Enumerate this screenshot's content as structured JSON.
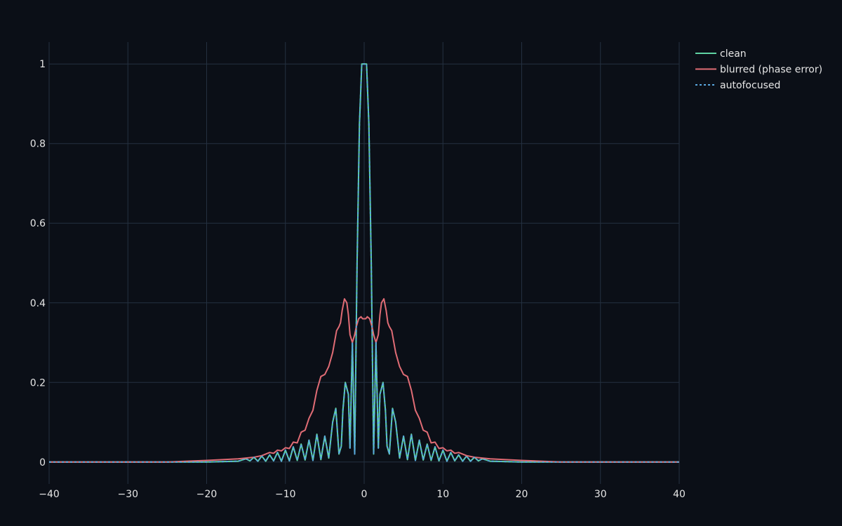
{
  "chart_data": {
    "type": "line",
    "title": "",
    "xlabel": "",
    "ylabel": "",
    "xlim": [
      -40,
      40
    ],
    "ylim": [
      -0.055,
      1.055
    ],
    "grid": true,
    "legend_position": "top-right",
    "x_ticks": [
      -40,
      -30,
      -20,
      -10,
      0,
      10,
      20,
      30,
      40
    ],
    "x_tick_labels": [
      "−40",
      "−30",
      "−20",
      "−10",
      "0",
      "10",
      "20",
      "30",
      "40"
    ],
    "y_ticks": [
      0,
      0.2,
      0.4,
      0.6,
      0.8,
      1
    ],
    "y_tick_labels": [
      "0",
      "0.2",
      "0.4",
      "0.6",
      "0.8",
      "1"
    ],
    "series": [
      {
        "name": "clean",
        "color": "#5fd3a3",
        "dash": "solid",
        "x": [
          -40,
          -30,
          -20,
          -16,
          -15,
          -14.5,
          -14,
          -13.5,
          -13,
          -12.5,
          -12,
          -11.5,
          -11,
          -10.5,
          -10,
          -9.5,
          -9,
          -8.5,
          -8,
          -7.5,
          -7,
          -6.5,
          -6,
          -5.5,
          -5,
          -4.5,
          -4,
          -3.6,
          -3.2,
          -2.9,
          -2.7,
          -2.4,
          -2.0,
          -1.8,
          -1.5,
          -1.2,
          -0.9,
          -0.6,
          -0.3,
          -0.15,
          0,
          0.15,
          0.3,
          0.6,
          0.9,
          1.2,
          1.5,
          1.8,
          2.0,
          2.4,
          2.7,
          2.9,
          3.2,
          3.6,
          4,
          4.5,
          5,
          5.5,
          6,
          6.5,
          7,
          7.5,
          8,
          8.5,
          9,
          9.5,
          10,
          10.5,
          11,
          11.5,
          12,
          12.5,
          13,
          13.5,
          14,
          14.5,
          15,
          16,
          20,
          30,
          40
        ],
        "y": [
          0,
          0,
          0,
          0.002,
          0.008,
          0.003,
          0.012,
          0.002,
          0.015,
          0.002,
          0.018,
          0.003,
          0.024,
          0.002,
          0.03,
          0.003,
          0.038,
          0.004,
          0.045,
          0.005,
          0.055,
          0.004,
          0.07,
          0.006,
          0.065,
          0.01,
          0.1,
          0.135,
          0.02,
          0.04,
          0.13,
          0.2,
          0.17,
          0.035,
          0.3,
          0.02,
          0.5,
          0.85,
          1.0,
          1.0,
          1.0,
          1.0,
          1.0,
          0.85,
          0.5,
          0.02,
          0.3,
          0.035,
          0.17,
          0.2,
          0.13,
          0.04,
          0.02,
          0.135,
          0.1,
          0.01,
          0.065,
          0.006,
          0.07,
          0.004,
          0.055,
          0.005,
          0.045,
          0.004,
          0.038,
          0.003,
          0.03,
          0.002,
          0.024,
          0.003,
          0.018,
          0.002,
          0.015,
          0.002,
          0.012,
          0.003,
          0.008,
          0.002,
          0,
          0,
          0
        ]
      },
      {
        "name": "blurred (phase error)",
        "color": "#e06c75",
        "dash": "solid",
        "x": [
          -40,
          -30,
          -25,
          -20,
          -18,
          -16,
          -14,
          -13,
          -12.5,
          -12,
          -11.5,
          -11,
          -10.5,
          -10,
          -9.5,
          -9,
          -8.5,
          -8,
          -7.5,
          -7,
          -6.5,
          -6,
          -5.5,
          -5,
          -4.5,
          -4,
          -3.5,
          -3.2,
          -3,
          -2.8,
          -2.5,
          -2.2,
          -2,
          -1.8,
          -1.5,
          -1.2,
          -1,
          -0.7,
          -0.4,
          -0.2,
          0,
          0.2,
          0.4,
          0.7,
          1,
          1.2,
          1.5,
          1.8,
          2,
          2.2,
          2.5,
          2.8,
          3,
          3.2,
          3.5,
          4,
          4.5,
          5,
          5.5,
          6,
          6.5,
          7,
          7.5,
          8,
          8.5,
          9,
          9.5,
          10,
          10.5,
          11,
          11.5,
          12,
          12.5,
          13,
          14,
          16,
          18,
          20,
          25,
          30,
          40
        ],
        "y": [
          0,
          0,
          0,
          0.004,
          0.006,
          0.008,
          0.012,
          0.016,
          0.02,
          0.024,
          0.022,
          0.03,
          0.028,
          0.036,
          0.034,
          0.05,
          0.048,
          0.075,
          0.08,
          0.11,
          0.13,
          0.18,
          0.215,
          0.22,
          0.24,
          0.275,
          0.33,
          0.34,
          0.35,
          0.38,
          0.41,
          0.4,
          0.37,
          0.32,
          0.3,
          0.32,
          0.34,
          0.36,
          0.365,
          0.36,
          0.36,
          0.36,
          0.365,
          0.36,
          0.34,
          0.32,
          0.3,
          0.32,
          0.37,
          0.4,
          0.41,
          0.38,
          0.35,
          0.34,
          0.33,
          0.275,
          0.24,
          0.22,
          0.215,
          0.18,
          0.13,
          0.11,
          0.08,
          0.075,
          0.048,
          0.05,
          0.034,
          0.036,
          0.028,
          0.03,
          0.022,
          0.024,
          0.02,
          0.016,
          0.012,
          0.008,
          0.006,
          0.004,
          0,
          0,
          0
        ]
      },
      {
        "name": "autofocused",
        "color": "#5aa8e0",
        "dash": "dotted",
        "x": [
          -40,
          -30,
          -20,
          -16,
          -15,
          -14.5,
          -14,
          -13.5,
          -13,
          -12.5,
          -12,
          -11.5,
          -11,
          -10.5,
          -10,
          -9.5,
          -9,
          -8.5,
          -8,
          -7.5,
          -7,
          -6.5,
          -6,
          -5.5,
          -5,
          -4.5,
          -4,
          -3.6,
          -3.2,
          -2.9,
          -2.7,
          -2.4,
          -2.0,
          -1.8,
          -1.5,
          -1.2,
          -0.9,
          -0.6,
          -0.3,
          -0.15,
          0,
          0.15,
          0.3,
          0.6,
          0.9,
          1.2,
          1.5,
          1.8,
          2.0,
          2.4,
          2.7,
          2.9,
          3.2,
          3.6,
          4,
          4.5,
          5,
          5.5,
          6,
          6.5,
          7,
          7.5,
          8,
          8.5,
          9,
          9.5,
          10,
          10.5,
          11,
          11.5,
          12,
          12.5,
          13,
          13.5,
          14,
          14.5,
          15,
          16,
          20,
          30,
          40
        ],
        "y": [
          0,
          0,
          0,
          0.002,
          0.008,
          0.003,
          0.012,
          0.002,
          0.015,
          0.002,
          0.018,
          0.003,
          0.024,
          0.002,
          0.03,
          0.003,
          0.038,
          0.004,
          0.045,
          0.005,
          0.055,
          0.004,
          0.07,
          0.006,
          0.065,
          0.01,
          0.1,
          0.135,
          0.02,
          0.04,
          0.13,
          0.2,
          0.17,
          0.035,
          0.3,
          0.02,
          0.5,
          0.85,
          1.0,
          1.0,
          1.0,
          1.0,
          1.0,
          0.85,
          0.5,
          0.02,
          0.3,
          0.035,
          0.17,
          0.2,
          0.13,
          0.04,
          0.02,
          0.135,
          0.1,
          0.01,
          0.065,
          0.006,
          0.07,
          0.004,
          0.055,
          0.005,
          0.045,
          0.004,
          0.038,
          0.003,
          0.03,
          0.002,
          0.024,
          0.003,
          0.018,
          0.002,
          0.015,
          0.002,
          0.012,
          0.003,
          0.008,
          0.002,
          0,
          0,
          0
        ]
      }
    ]
  }
}
